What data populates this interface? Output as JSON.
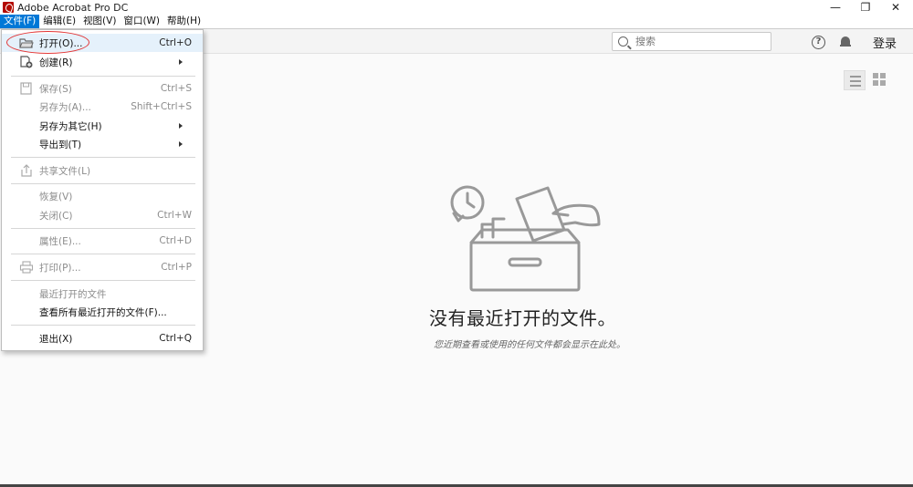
{
  "window": {
    "title": "Adobe Acrobat Pro DC",
    "minimize": "—",
    "restore": "❐",
    "close": "✕"
  },
  "menubar": {
    "items": [
      "文件(F)",
      "编辑(E)",
      "视图(V)",
      "窗口(W)",
      "帮助(H)"
    ]
  },
  "toolbar": {
    "search_placeholder": "搜索",
    "help": "?",
    "login": "登录"
  },
  "file_menu": {
    "items": [
      {
        "label": "打开(O)...",
        "shortcut": "Ctrl+O"
      },
      {
        "label": "创建(R)",
        "shortcut": ""
      },
      {
        "label": "保存(S)",
        "shortcut": "Ctrl+S"
      },
      {
        "label": "另存为(A)...",
        "shortcut": "Shift+Ctrl+S"
      },
      {
        "label": "另存为其它(H)",
        "shortcut": ""
      },
      {
        "label": "导出到(T)",
        "shortcut": ""
      },
      {
        "label": "共享文件(L)",
        "shortcut": ""
      },
      {
        "label": "恢复(V)",
        "shortcut": ""
      },
      {
        "label": "关闭(C)",
        "shortcut": "Ctrl+W"
      },
      {
        "label": "属性(E)...",
        "shortcut": "Ctrl+D"
      },
      {
        "label": "打印(P)...",
        "shortcut": "Ctrl+P"
      },
      {
        "label": "最近打开的文件",
        "shortcut": ""
      },
      {
        "label": "查看所有最近打开的文件(F)...",
        "shortcut": ""
      },
      {
        "label": "退出(X)",
        "shortcut": "Ctrl+Q"
      }
    ]
  },
  "empty_state": {
    "title": "没有最近打开的文件。",
    "subtitle": "您近期查看或使用的任何文件都会显示在此处。"
  },
  "colors": {
    "menu_active": "#0078d7",
    "annotation": "#e23535"
  }
}
